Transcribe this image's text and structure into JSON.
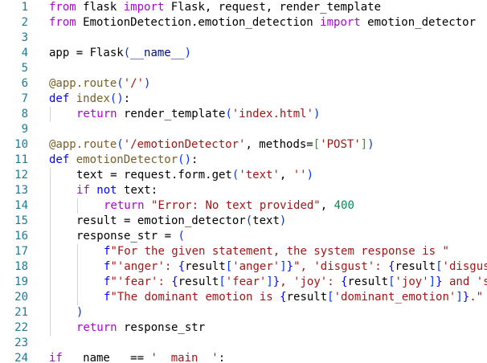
{
  "colors": {
    "line_number": "#237893",
    "plain": "#000000",
    "keyword": "#af00db",
    "def": "#0000ff",
    "function": "#795e26",
    "string": "#a31515",
    "number": "#098658",
    "variable": "#001080",
    "bracket_1": "#0431fa",
    "bracket_2": "#319331",
    "bracket_3": "#7b3814",
    "decorator": "#795e26",
    "indent_guide": "#d3d3d3"
  },
  "lines": [
    {
      "n": "1",
      "indent": 0,
      "tokens": [
        [
          "from",
          "keyword"
        ],
        [
          " flask ",
          "plain"
        ],
        [
          "import",
          "keyword"
        ],
        [
          " Flask, request, render_template",
          "plain"
        ]
      ]
    },
    {
      "n": "2",
      "indent": 0,
      "tokens": [
        [
          "from",
          "keyword"
        ],
        [
          " EmotionDetection.emotion_detection ",
          "plain"
        ],
        [
          "import",
          "keyword"
        ],
        [
          " emotion_detector",
          "plain"
        ]
      ]
    },
    {
      "n": "3",
      "indent": 0,
      "tokens": []
    },
    {
      "n": "4",
      "indent": 0,
      "tokens": [
        [
          "app = Flask",
          "plain"
        ],
        [
          "(",
          "bracket_1"
        ],
        [
          "__name__",
          "variable"
        ],
        [
          ")",
          "bracket_1"
        ]
      ]
    },
    {
      "n": "5",
      "indent": 0,
      "tokens": []
    },
    {
      "n": "6",
      "indent": 0,
      "tokens": [
        [
          "@app.route",
          "decorator"
        ],
        [
          "(",
          "bracket_1"
        ],
        [
          "'/'",
          "string"
        ],
        [
          ")",
          "bracket_1"
        ]
      ]
    },
    {
      "n": "7",
      "indent": 0,
      "tokens": [
        [
          "def",
          "def"
        ],
        [
          " ",
          "plain"
        ],
        [
          "index",
          "function"
        ],
        [
          "()",
          "bracket_1"
        ],
        [
          ":",
          "plain"
        ]
      ]
    },
    {
      "n": "8",
      "indent": 1,
      "tokens": [
        [
          "return",
          "keyword"
        ],
        [
          " render_template",
          "plain"
        ],
        [
          "(",
          "bracket_1"
        ],
        [
          "'index.html'",
          "string"
        ],
        [
          ")",
          "bracket_1"
        ]
      ]
    },
    {
      "n": "9",
      "indent": 0,
      "tokens": []
    },
    {
      "n": "10",
      "indent": 0,
      "tokens": [
        [
          "@app.route",
          "decorator"
        ],
        [
          "(",
          "bracket_1"
        ],
        [
          "'/emotionDetector'",
          "string"
        ],
        [
          ", methods=",
          "plain"
        ],
        [
          "[",
          "bracket_2"
        ],
        [
          "'POST'",
          "string"
        ],
        [
          "]",
          "bracket_2"
        ],
        [
          ")",
          "bracket_1"
        ]
      ]
    },
    {
      "n": "11",
      "indent": 0,
      "tokens": [
        [
          "def",
          "def"
        ],
        [
          " ",
          "plain"
        ],
        [
          "emotionDetector",
          "function"
        ],
        [
          "()",
          "bracket_1"
        ],
        [
          ":",
          "plain"
        ]
      ]
    },
    {
      "n": "12",
      "indent": 1,
      "tokens": [
        [
          "text = request.form.get",
          "plain"
        ],
        [
          "(",
          "bracket_1"
        ],
        [
          "'text'",
          "string"
        ],
        [
          ", ",
          "plain"
        ],
        [
          "''",
          "string"
        ],
        [
          ")",
          "bracket_1"
        ]
      ]
    },
    {
      "n": "13",
      "indent": 1,
      "tokens": [
        [
          "if",
          "keyword"
        ],
        [
          " ",
          "plain"
        ],
        [
          "not",
          "def"
        ],
        [
          " text:",
          "plain"
        ]
      ]
    },
    {
      "n": "14",
      "indent": 2,
      "tokens": [
        [
          "return",
          "keyword"
        ],
        [
          " ",
          "plain"
        ],
        [
          "\"Error: No text provided\"",
          "string"
        ],
        [
          ", ",
          "plain"
        ],
        [
          "400",
          "number"
        ]
      ]
    },
    {
      "n": "15",
      "indent": 1,
      "tokens": [
        [
          "result = emotion_detector",
          "plain"
        ],
        [
          "(",
          "bracket_1"
        ],
        [
          "text",
          "plain"
        ],
        [
          ")",
          "bracket_1"
        ]
      ]
    },
    {
      "n": "16",
      "indent": 1,
      "tokens": [
        [
          "response_str = ",
          "plain"
        ],
        [
          "(",
          "bracket_1"
        ]
      ]
    },
    {
      "n": "17",
      "indent": 2,
      "tokens": [
        [
          "f",
          "def"
        ],
        [
          "\"For the given statement, the system response is \"",
          "string"
        ]
      ]
    },
    {
      "n": "18",
      "indent": 2,
      "tokens": [
        [
          "f",
          "def"
        ],
        [
          "\"'anger': ",
          "string"
        ],
        [
          "{",
          "def"
        ],
        [
          "result",
          "plain"
        ],
        [
          "[",
          "bracket_1"
        ],
        [
          "'anger'",
          "string"
        ],
        [
          "]",
          "bracket_1"
        ],
        [
          "}",
          "def"
        ],
        [
          "\", 'disgust': ",
          "string"
        ],
        [
          "{",
          "def"
        ],
        [
          "result",
          "plain"
        ],
        [
          "[",
          "bracket_1"
        ],
        [
          "'disgust'",
          "string"
        ]
      ]
    },
    {
      "n": "19",
      "indent": 2,
      "tokens": [
        [
          "f",
          "def"
        ],
        [
          "\"'fear': ",
          "string"
        ],
        [
          "{",
          "def"
        ],
        [
          "result",
          "plain"
        ],
        [
          "[",
          "bracket_1"
        ],
        [
          "'fear'",
          "string"
        ],
        [
          "]",
          "bracket_1"
        ],
        [
          "}",
          "def"
        ],
        [
          ", 'joy': ",
          "string"
        ],
        [
          "{",
          "def"
        ],
        [
          "result",
          "plain"
        ],
        [
          "[",
          "bracket_1"
        ],
        [
          "'joy'",
          "string"
        ],
        [
          "]",
          "bracket_1"
        ],
        [
          "}",
          "def"
        ],
        [
          " and 's",
          "string"
        ]
      ]
    },
    {
      "n": "20",
      "indent": 2,
      "tokens": [
        [
          "f",
          "def"
        ],
        [
          "\"The dominant emotion is ",
          "string"
        ],
        [
          "{",
          "def"
        ],
        [
          "result",
          "plain"
        ],
        [
          "[",
          "bracket_1"
        ],
        [
          "'dominant_emotion'",
          "string"
        ],
        [
          "]",
          "bracket_1"
        ],
        [
          "}",
          "def"
        ],
        [
          ".\"",
          "string"
        ]
      ]
    },
    {
      "n": "21",
      "indent": 1,
      "tokens": [
        [
          ")",
          "bracket_1"
        ]
      ]
    },
    {
      "n": "22",
      "indent": 1,
      "tokens": [
        [
          "return",
          "keyword"
        ],
        [
          " response_str",
          "plain"
        ]
      ]
    },
    {
      "n": "23",
      "indent": 0,
      "tokens": []
    },
    {
      "n": "24",
      "indent": 0,
      "tokens": [
        [
          "if",
          "keyword"
        ],
        [
          " __name__ == ",
          "plain"
        ],
        [
          "'__main__'",
          "string"
        ],
        [
          ":",
          "plain"
        ]
      ]
    }
  ]
}
